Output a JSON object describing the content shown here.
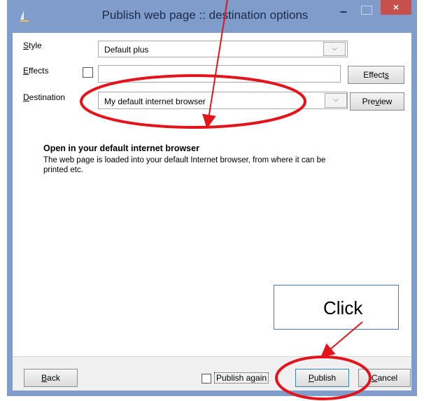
{
  "window": {
    "title": "Publish web page :: destination options",
    "controls": {
      "minimize": "–",
      "close": "×"
    }
  },
  "form": {
    "style": {
      "label_pre": "",
      "label_u": "S",
      "label_post": "tyle",
      "value": "Default plus"
    },
    "effects": {
      "label_pre": "",
      "label_u": "E",
      "label_post": "ffects",
      "value": "",
      "checked": false,
      "button_pre": "Effect",
      "button_u": "s",
      "button_post": ""
    },
    "destination": {
      "label_pre": "",
      "label_u": "D",
      "label_post": "estination",
      "value": "My default internet browser",
      "button_pre": "Pre",
      "button_u": "v",
      "button_post": "iew"
    }
  },
  "info": {
    "title": "Open in your default internet browser",
    "text": "The web page is loaded into your default Internet browser, from where it can be printed etc."
  },
  "footer": {
    "back": {
      "u": "B",
      "rest": "ack"
    },
    "publish_again": {
      "label": "Publish again",
      "checked": false
    },
    "publish": {
      "u": "P",
      "rest": "ublish"
    },
    "cancel": {
      "u": "C",
      "rest": "ancel"
    }
  },
  "annotation": {
    "callout_text": "Click",
    "color": "#e3141c",
    "callout_border": "#4a76c0"
  }
}
